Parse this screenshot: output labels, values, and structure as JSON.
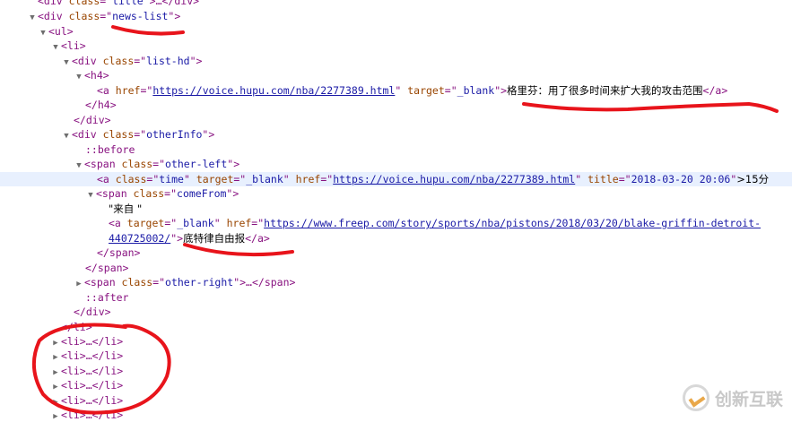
{
  "dom": {
    "title_div": {
      "class": "title"
    },
    "news_list": {
      "class": "news-list"
    },
    "list_hd": {
      "class": "list-hd"
    },
    "h4_link": {
      "href": "https://voice.hupu.com/nba/2277389.html",
      "target": "_blank",
      "text": "格里芬：用了很多时间来扩大我的攻击范围"
    },
    "other_info": {
      "class": "otherInfo"
    },
    "pseudo_before": "::before",
    "pseudo_after": "::after",
    "other_left": {
      "class": "other-left"
    },
    "time_link": {
      "class": "time",
      "target": "_blank",
      "href": "https://voice.hupu.com/nba/2277389.html",
      "title": "2018-03-20 20:06",
      "text_tail": ">15分"
    },
    "come_from": {
      "class": "comeFrom"
    },
    "come_from_text": "\"来自 \"",
    "source_link": {
      "target": "_blank",
      "href_part1": "https://www.freep.com/story/sports/nba/pistons/2018/03/20/blake-griffin-detroit-",
      "href_part2": "440725002/",
      "text": "底特律自由报"
    },
    "other_right": {
      "class": "other-right"
    },
    "li_collapsed_label": "<li>…</li>"
  },
  "watermark": {
    "text": "创新互联"
  },
  "colors": {
    "tag": "#881280",
    "attr_name": "#994500",
    "attr_value": "#1a1aa6",
    "annotation_red": "#e8141b"
  }
}
